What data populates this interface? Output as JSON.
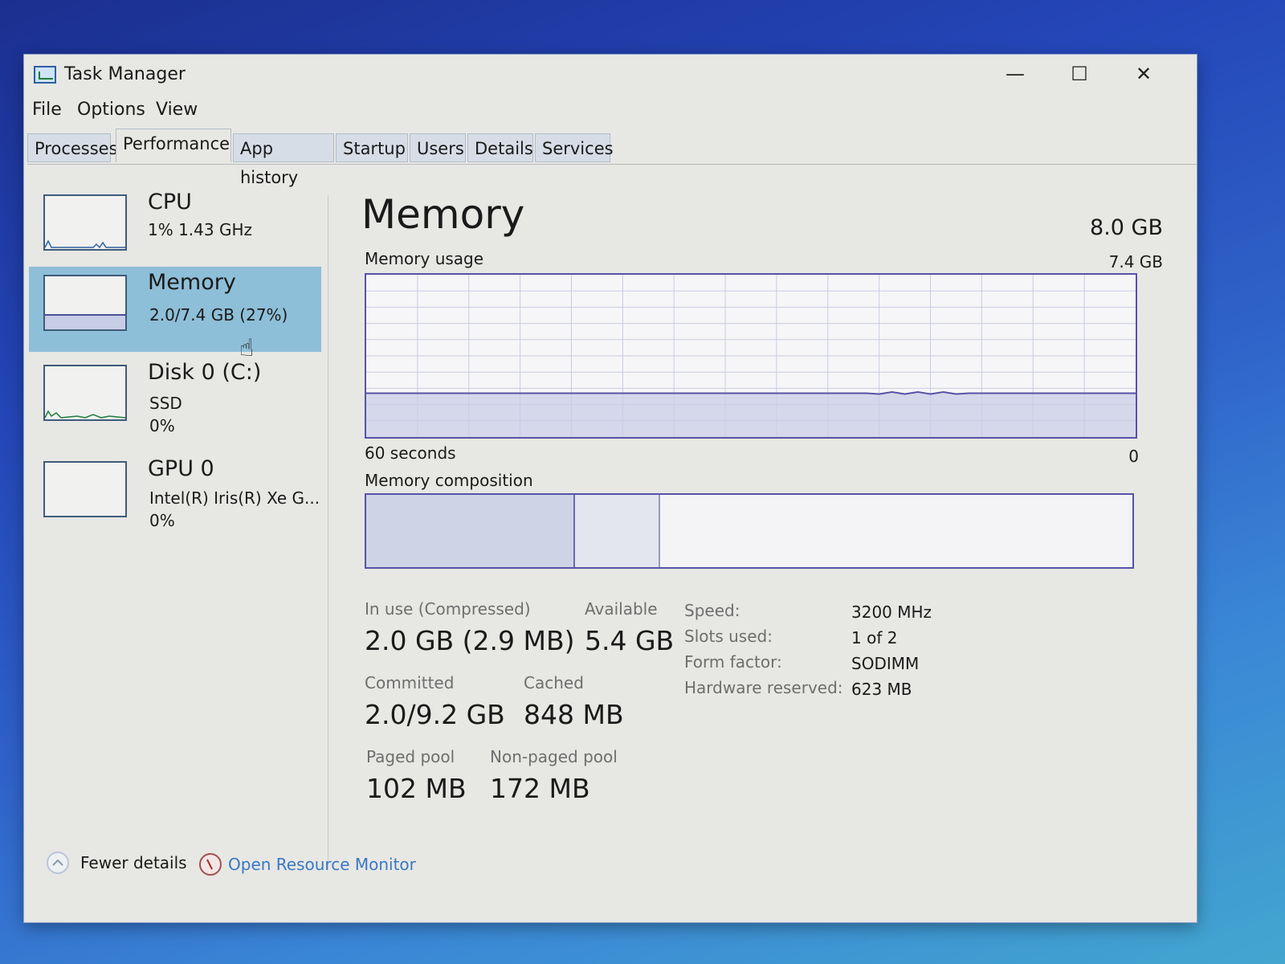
{
  "window": {
    "title": "Task Manager",
    "minimize": "—",
    "maximize": "☐",
    "close": "✕"
  },
  "menu": [
    "File",
    "Options",
    "View"
  ],
  "tabs": [
    "Processes",
    "Performance",
    "App history",
    "Startup",
    "Users",
    "Details",
    "Services"
  ],
  "active_tab": "Performance",
  "sidebar": [
    {
      "name": "CPU",
      "line1": "1%  1.43 GHz",
      "line2": ""
    },
    {
      "name": "Memory",
      "line1": "2.0/7.4 GB (27%)",
      "line2": ""
    },
    {
      "name": "Disk 0 (C:)",
      "line1": "SSD",
      "line2": "0%"
    },
    {
      "name": "GPU 0",
      "line1": "Intel(R) Iris(R) Xe G...",
      "line2": "0%"
    }
  ],
  "selected_resource": "Memory",
  "memory": {
    "title": "Memory",
    "total": "8.0 GB",
    "usage_label": "Memory usage",
    "usage_max": "7.4 GB",
    "axis_left": "60 seconds",
    "axis_right": "0",
    "composition_label": "Memory composition",
    "usage_fraction": 0.27
  },
  "stats": {
    "in_use_label": "In use (Compressed)",
    "in_use_value": "2.0 GB (2.9 MB)",
    "available_label": "Available",
    "available_value": "5.4 GB",
    "committed_label": "Committed",
    "committed_value": "2.0/9.2 GB",
    "cached_label": "Cached",
    "cached_value": "848 MB",
    "paged_label": "Paged pool",
    "paged_value": "102 MB",
    "nonpaged_label": "Non-paged pool",
    "nonpaged_value": "172 MB"
  },
  "details": [
    {
      "key": "Speed:",
      "value": "3200 MHz"
    },
    {
      "key": "Slots used:",
      "value": "1 of 2"
    },
    {
      "key": "Form factor:",
      "value": "SODIMM"
    },
    {
      "key": "Hardware reserved:",
      "value": "623 MB"
    }
  ],
  "footer": {
    "fewer_details": "Fewer details",
    "open_resource_monitor": "Open Resource Monitor"
  },
  "colors": {
    "accent": "#5752a8",
    "selected": "#8ebfd8",
    "link": "#3a78c2"
  }
}
